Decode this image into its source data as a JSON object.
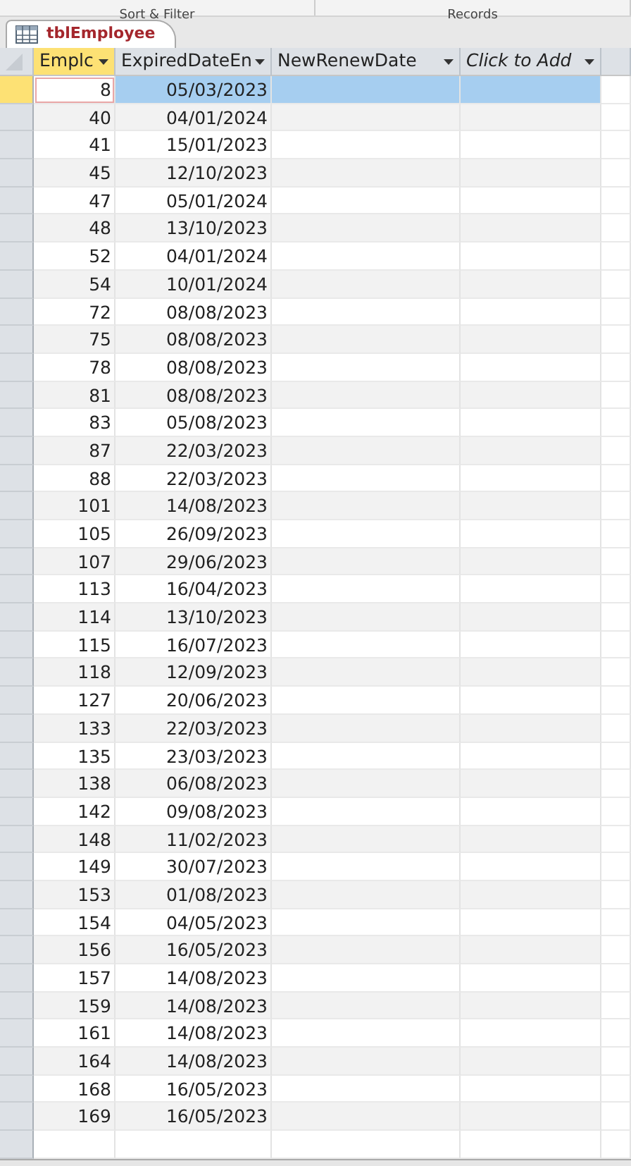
{
  "ribbon_groups": [
    "Sort & Filter",
    "Records"
  ],
  "tab": {
    "title": "tblEmployee"
  },
  "columns": [
    {
      "label": "Emplc",
      "selected": true,
      "italic": false
    },
    {
      "label": "ExpiredDateEn",
      "selected": false,
      "italic": false
    },
    {
      "label": "NewRenewDate",
      "selected": false,
      "italic": false
    },
    {
      "label": "Click to Add",
      "selected": false,
      "italic": true
    }
  ],
  "rows": [
    {
      "id": "8",
      "date": "05/03/2023",
      "selected": true
    },
    {
      "id": "40",
      "date": "04/01/2024",
      "selected": false
    },
    {
      "id": "41",
      "date": "15/01/2023",
      "selected": false
    },
    {
      "id": "45",
      "date": "12/10/2023",
      "selected": false
    },
    {
      "id": "47",
      "date": "05/01/2024",
      "selected": false
    },
    {
      "id": "48",
      "date": "13/10/2023",
      "selected": false
    },
    {
      "id": "52",
      "date": "04/01/2024",
      "selected": false
    },
    {
      "id": "54",
      "date": "10/01/2024",
      "selected": false
    },
    {
      "id": "72",
      "date": "08/08/2023",
      "selected": false
    },
    {
      "id": "75",
      "date": "08/08/2023",
      "selected": false
    },
    {
      "id": "78",
      "date": "08/08/2023",
      "selected": false
    },
    {
      "id": "81",
      "date": "08/08/2023",
      "selected": false
    },
    {
      "id": "83",
      "date": "05/08/2023",
      "selected": false
    },
    {
      "id": "87",
      "date": "22/03/2023",
      "selected": false
    },
    {
      "id": "88",
      "date": "22/03/2023",
      "selected": false
    },
    {
      "id": "101",
      "date": "14/08/2023",
      "selected": false
    },
    {
      "id": "105",
      "date": "26/09/2023",
      "selected": false
    },
    {
      "id": "107",
      "date": "29/06/2023",
      "selected": false
    },
    {
      "id": "113",
      "date": "16/04/2023",
      "selected": false
    },
    {
      "id": "114",
      "date": "13/10/2023",
      "selected": false
    },
    {
      "id": "115",
      "date": "16/07/2023",
      "selected": false
    },
    {
      "id": "118",
      "date": "12/09/2023",
      "selected": false
    },
    {
      "id": "127",
      "date": "20/06/2023",
      "selected": false
    },
    {
      "id": "133",
      "date": "22/03/2023",
      "selected": false
    },
    {
      "id": "135",
      "date": "23/03/2023",
      "selected": false
    },
    {
      "id": "138",
      "date": "06/08/2023",
      "selected": false
    },
    {
      "id": "142",
      "date": "09/08/2023",
      "selected": false
    },
    {
      "id": "148",
      "date": "11/02/2023",
      "selected": false
    },
    {
      "id": "149",
      "date": "30/07/2023",
      "selected": false
    },
    {
      "id": "153",
      "date": "01/08/2023",
      "selected": false
    },
    {
      "id": "154",
      "date": "04/05/2023",
      "selected": false
    },
    {
      "id": "156",
      "date": "16/05/2023",
      "selected": false
    },
    {
      "id": "157",
      "date": "14/08/2023",
      "selected": false
    },
    {
      "id": "159",
      "date": "14/08/2023",
      "selected": false
    },
    {
      "id": "161",
      "date": "14/08/2023",
      "selected": false
    },
    {
      "id": "164",
      "date": "14/08/2023",
      "selected": false
    },
    {
      "id": "168",
      "date": "16/05/2023",
      "selected": false
    },
    {
      "id": "169",
      "date": "16/05/2023",
      "selected": false
    }
  ]
}
